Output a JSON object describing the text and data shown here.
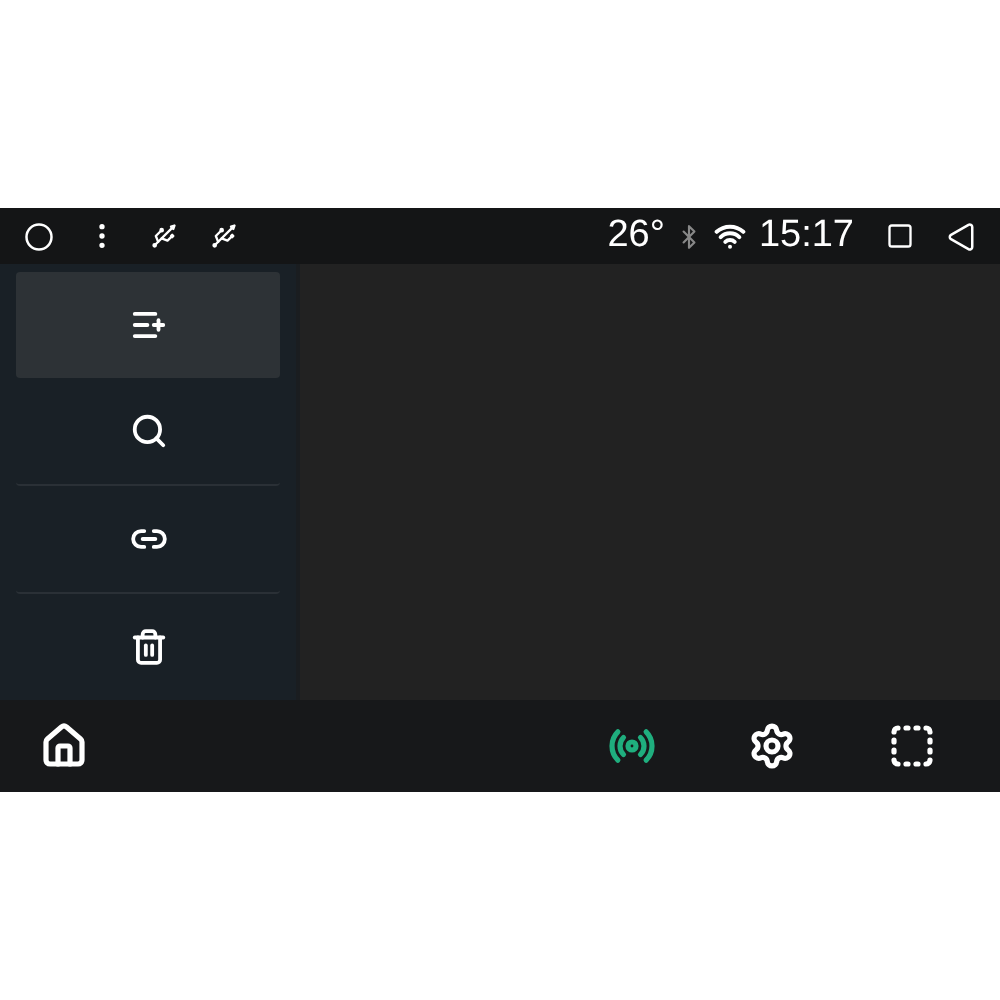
{
  "status_bar": {
    "temperature": "26°",
    "time": "15:17"
  },
  "sidebar": {
    "items": [
      {
        "kind": "list",
        "selected": true
      },
      {
        "kind": "search",
        "selected": false
      },
      {
        "kind": "link",
        "selected": false
      },
      {
        "kind": "delete",
        "selected": false
      }
    ]
  },
  "bottom_bar": {
    "items": [
      {
        "kind": "home",
        "active": false
      },
      {
        "kind": "broadcast",
        "active": true
      },
      {
        "kind": "settings",
        "active": false
      },
      {
        "kind": "screen",
        "active": false
      }
    ]
  }
}
